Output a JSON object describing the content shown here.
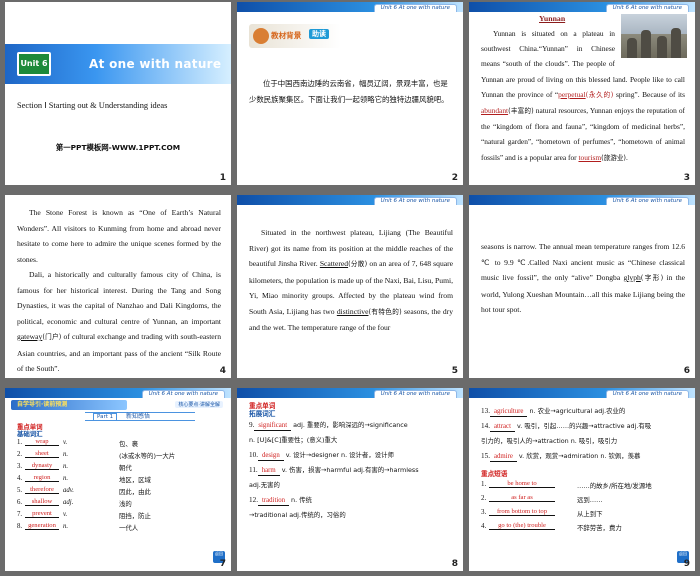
{
  "common": {
    "unit_tab": "Unit 6 At one with nature"
  },
  "slide1": {
    "num": "1",
    "unit_label": "Unit 6",
    "title": "At one with nature",
    "section": "Section Ⅰ Starting out & Understanding ideas",
    "ppt_label": "第一PPT模板网-WWW.1PPT.COM"
  },
  "slide2": {
    "num": "2",
    "banner_label": "教材背景",
    "banner_tag": "助读",
    "text": "位于中国西南边陲的云南省，幅员辽阔，景观丰富，也是少数民族聚集区。下面让我们一起领略它的独特边疆风貌吧。"
  },
  "slide3": {
    "num": "3",
    "title": "Yunnan",
    "p1": "Yunnan is situated on a plateau in southwest China.“Yunnan” in Chinese means “south of the clouds”. The people of Yunnan are proud of living on this blessed land. People like to call Yunnan the province of “",
    "perpetual": "perpetual",
    "perpetual_cn": "(永久的)",
    "p2": " spring”. Because of its ",
    "abundant": "abundant",
    "abundant_cn": "(丰富的)",
    "p3": " natural resources, Yunnan enjoys the reputation of the “kingdom of flora and fauna”, “kingdom of medicinal herbs”, “natural garden”, “hometown of perfumes”, “hometown of animal fossils” and is a popular area for ",
    "tourism": "tourism",
    "tourism_cn": "(旅游业)",
    "p4": "."
  },
  "slide4": {
    "num": "4",
    "p1": "The Stone Forest is known as “One of Earth’s Natural Wonders”. All visitors to Kunming from home and abroad never hesitate to come here to admire the unique scenes formed by the stones.",
    "p2a": "Dali, a historically and culturally famous city of China, is famous for her historical interest. During the Tang and Song Dynasties, it was the capital of Nanzhao and Dali Kingdoms, the political, economic and cultural centre of Yunnan, an important ",
    "gateway": "gateway",
    "gateway_cn": "(门户)",
    "p2b": " of cultural exchange and trading with south-eastern Asian countries, and an important pass of the ancient “Silk Route of the South”."
  },
  "slide5": {
    "num": "5",
    "p1": "Situated in the northwest plateau, Lijiang (The Beautiful River) got its name from its position at the middle reaches of the beautiful Jinsha River.",
    "scattered": "Scattered",
    "scattered_cn": "(分散)",
    "p2": " on an area of 7, 648 square kilometers, the population is made up of the Naxi, Bai, Lisu, Pumi, Yi, Miao minority groups. Affected by the plateau wind from South Asia, Lijiang has two ",
    "distinctive": "distinctive",
    "distinctive_cn": "(有特色的)",
    "p3": " seasons, the dry and the wet. The temperature range of the four"
  },
  "slide6": {
    "num": "6",
    "p1": "seasons is narrow. The annual mean temperature ranges from 12.6 ℃ to 9.9 ℃.Called Naxi ancient music as “Chinese classical music live fossil”, the only “alive” Dongba ",
    "glyph": "glyph",
    "glyph_cn": "(字形)",
    "p2": " in the world, Yulong Xueshan Mountain…all this make Lijiang being the hot tour spot."
  },
  "slide7": {
    "num": "7",
    "strip_label": "自学导引·读前预测",
    "right_tag": "核心要点·讲解全解",
    "part_badge": "Part 1",
    "part_name": "新知感悟",
    "sub1": "重点单词",
    "sub2": "基础词汇",
    "rows": [
      {
        "n": "1.",
        "word": "wrap",
        "pos": "v.",
        "mean": "包、裹"
      },
      {
        "n": "2.",
        "word": "sheet",
        "pos": "n.",
        "mean": "(冰或水等的)一大片"
      },
      {
        "n": "3.",
        "word": "dynasty",
        "pos": "n.",
        "mean": "朝代"
      },
      {
        "n": "4.",
        "word": "region",
        "pos": "n.",
        "mean": "地区，区域"
      },
      {
        "n": "5.",
        "word": "therefore",
        "pos": "adv.",
        "mean": "因此，由此"
      },
      {
        "n": "6.",
        "word": "shallow",
        "pos": "adj.",
        "mean": "浅的"
      },
      {
        "n": "7.",
        "word": "prevent",
        "pos": "v.",
        "mean": "阻挡，防止"
      },
      {
        "n": "8.",
        "word": "generation",
        "pos": "n.",
        "mean": "一代人"
      }
    ],
    "nav": "返回"
  },
  "slide8": {
    "num": "8",
    "h1": "重点单词",
    "h2": "拓展词汇",
    "l9a": "9.",
    "significant": "significant",
    "l9b": " adj. 重要的，影响深远的→significance",
    "l9c": "n. [U]&[C]重要性；(意义)重大",
    "l10a": "10.",
    "design": "design",
    "l10b": " v. 设计→designer n. 设计者，设计师",
    "l11a": "11.",
    "harm": "harm",
    "l11b": " v. 伤害，损害→harmful adj.有害的→harmless",
    "l11c": "adj.无害的",
    "l12a": "12.",
    "tradition": "tradition",
    "l12b": " n. 传统",
    "l12c": "→traditional adj.传统的，习俗的"
  },
  "slide9": {
    "num": "9",
    "l13a": "13.",
    "agriculture": "agriculture",
    "l13b": " n. 农业→agricultural adj.农业的",
    "l14a": "14.",
    "attract": "attract",
    "l14b": " v. 吸引，引起……的兴趣→attractive adj.有吸",
    "l14c": "引力的，吸引人的→attraction n. 吸引，吸引力",
    "l15a": "15.",
    "admire": "admire",
    "l15b": " v. 欣赏，观赏→admiration n. 钦佩，羡慕",
    "h1": "重点短语",
    "rows": [
      {
        "n": "1.",
        "phrase": "be home to",
        "mean": "……的故乡/所在地/发源地"
      },
      {
        "n": "2.",
        "phrase": "as far as",
        "mean": "远到……"
      },
      {
        "n": "3.",
        "phrase": "from bottom to top",
        "mean": "从上到下"
      },
      {
        "n": "4.",
        "phrase": "go to (the) trouble",
        "mean": "不辞劳苦，费力"
      }
    ],
    "nav": "返回"
  }
}
